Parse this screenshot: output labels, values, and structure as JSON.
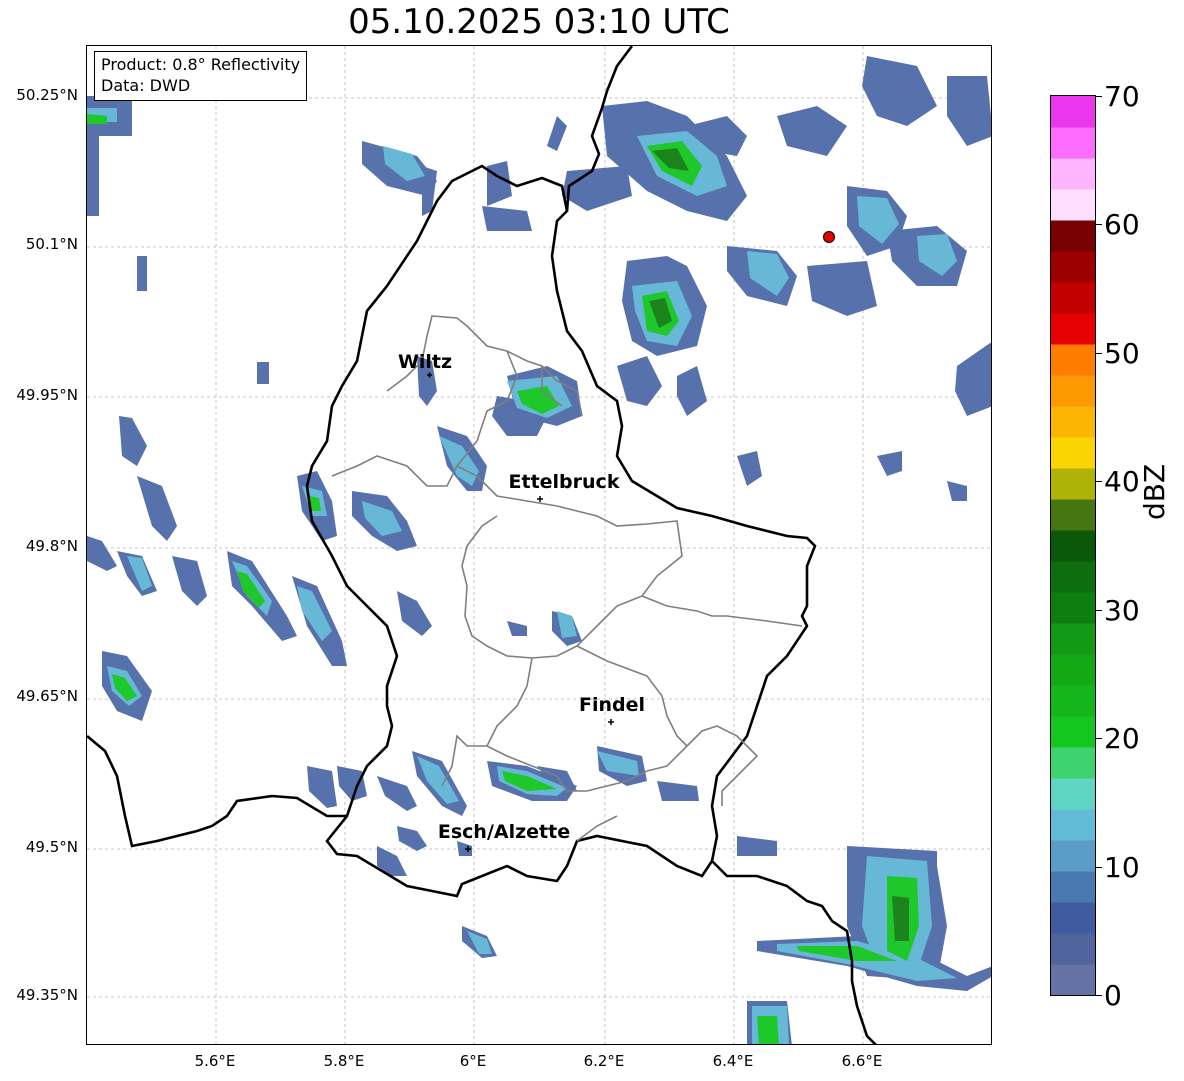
{
  "title": "05.10.2025 03:10 UTC",
  "info_box": {
    "product": "Product: 0.8° Reflectivity",
    "data": "Data: DWD"
  },
  "lat_labels": [
    "50.25°N",
    "50.1°N",
    "49.95°N",
    "49.8°N",
    "49.65°N",
    "49.5°N",
    "49.35°N"
  ],
  "lon_labels": [
    "5.6°E",
    "5.8°E",
    "6°E",
    "6.2°E",
    "6.4°E",
    "6.6°E"
  ],
  "cities": [
    {
      "name": "Wiltz"
    },
    {
      "name": "Ettelbruck"
    },
    {
      "name": "Findel"
    },
    {
      "name": "Esch/Alzette"
    }
  ],
  "colorbar": {
    "unit": "dBZ",
    "ticks": [
      "0",
      "10",
      "20",
      "30",
      "40",
      "50",
      "60",
      "70"
    ],
    "colors": [
      "#6473a3",
      "#52649e",
      "#405ca1",
      "#4a79b1",
      "#5a9dc6",
      "#62bcd8",
      "#5fd6c4",
      "#3dd46f",
      "#13c620",
      "#14b71b",
      "#13a816",
      "#129a16",
      "#0f7e10",
      "#0e6d0e",
      "#0b580b",
      "#467611",
      "#afb305",
      "#fbd502",
      "#fcb502",
      "#fc9801",
      "#fe7d00",
      "#e60002",
      "#c20000",
      "#9d0001",
      "#770000",
      "#ffdfff",
      "#ffb4ff",
      "#fc6cfe",
      "#ea37ee"
    ]
  }
}
